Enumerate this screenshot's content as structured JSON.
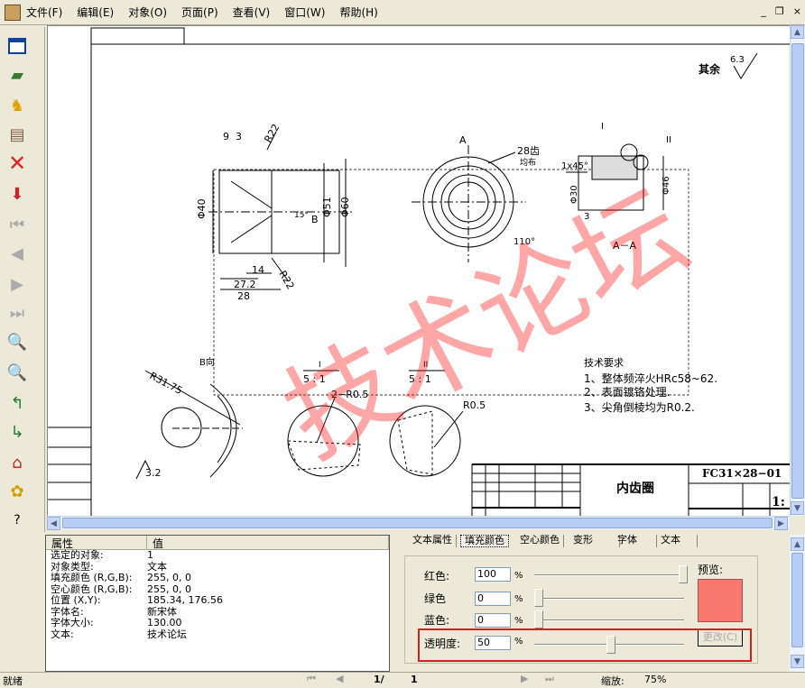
{
  "menu": [
    "文件(F)",
    "编辑(E)",
    "对象(O)",
    "页面(P)",
    "查看(V)",
    "窗口(W)",
    "帮助(H)"
  ],
  "window_buttons": [
    "_",
    "❐",
    "×"
  ],
  "drawing": {
    "watermark": "技术论坛",
    "watermark_color": "#ff0000",
    "roughness_rest": "其余",
    "roughness_value": "6.3",
    "dims": {
      "d9": "9",
      "d3": "3",
      "r22": "R22",
      "phi40": "Φ40",
      "phi51": "Φ51",
      "phi60": "Φ60",
      "a15": "15°",
      "b": "B",
      "d14": "14",
      "d272": "27.2",
      "d28": "28",
      "r22b": "R22",
      "a": "A",
      "teeth": "28齿",
      "even": "均布",
      "a110": "110°",
      "aa": "A－A",
      "chamfer": "1x45°",
      "phi30": "Φ30",
      "phi46": "Φ46",
      "d3b": "3",
      "i": "I",
      "ii": "II",
      "bdir": "B向",
      "r3175": "R31.75",
      "r32": "3.2",
      "detail_i": "I",
      "scale_i": "5 : 1",
      "detail_ii": "II",
      "scale_ii": "5 : 1",
      "r05a": "2−R0.5",
      "r05b": "R0.5"
    },
    "requirements": [
      "技术要求",
      "1、整体频淬火HRc58~62.",
      "2、表面镀铬处理.",
      "3、尖角倒棱均为R0.2."
    ],
    "title_part": "内齿圈",
    "drawing_no": "FC31×28−01",
    "scale": "1:"
  },
  "properties": {
    "headers": [
      "属性",
      "值"
    ],
    "rows": [
      [
        "选定的对象:",
        "1"
      ],
      [
        "对象类型:",
        "文本"
      ],
      [
        "填充颜色 (R,G,B):",
        "255, 0, 0"
      ],
      [
        "空心颜色 (R,G,B):",
        "255, 0, 0"
      ],
      [
        "位置 (X,Y):",
        "185.34, 176.56"
      ],
      [
        "字体名:",
        "新宋体"
      ],
      [
        "字体大小:",
        "130.00"
      ],
      [
        "文本:",
        "技术论坛"
      ]
    ]
  },
  "tabs": [
    "文本属性",
    "填充颜色",
    "空心颜色",
    "变形",
    "字体",
    "文本"
  ],
  "fill": {
    "red_label": "红色:",
    "red": "100",
    "green_label": "绿色",
    "green": "0",
    "blue_label": "蓝色:",
    "blue": "0",
    "alpha_label": "透明度:",
    "alpha": "50",
    "pct": "%",
    "preview_label": "预览:",
    "preview_color": "#f87870",
    "change_button": "更改(C)"
  },
  "status": {
    "ready": "就绪",
    "page": "1/",
    "page_total": "1",
    "zoom_label": "缩放:",
    "zoom": "75%"
  }
}
